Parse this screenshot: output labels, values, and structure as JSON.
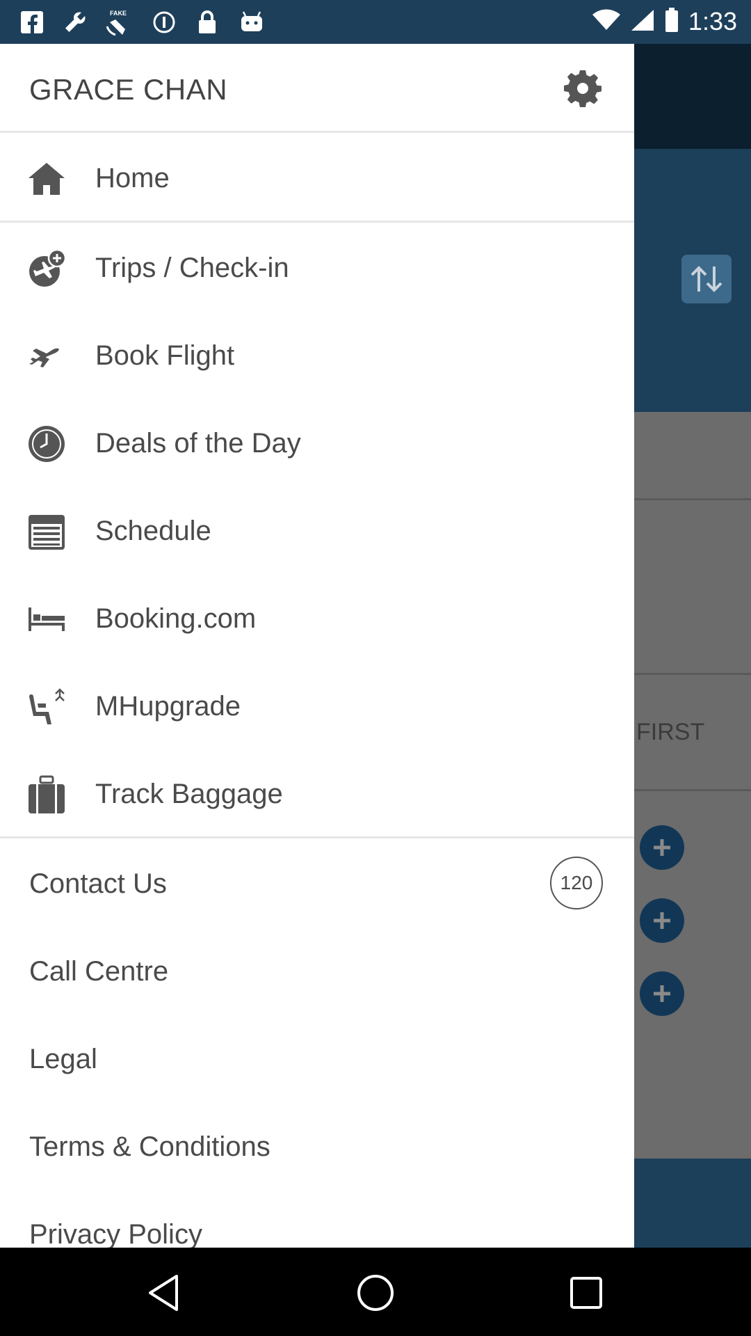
{
  "status_bar": {
    "time": "1:33",
    "left_icons": [
      "facebook-icon",
      "wrench-icon",
      "fake-gps-icon",
      "info-icon",
      "lock-icon",
      "android-icon"
    ],
    "right_icons": [
      "wifi-icon",
      "signal-icon",
      "battery-icon"
    ]
  },
  "drawer": {
    "user_name": "GRACE CHAN",
    "settings_icon": "gear-icon",
    "nav_items": [
      {
        "label": "Home",
        "icon": "home-icon"
      },
      {
        "label": "Trips / Check-in",
        "icon": "trips-checkin-icon"
      },
      {
        "label": "Book Flight",
        "icon": "airplane-icon"
      },
      {
        "label": "Deals of the Day",
        "icon": "clock-icon"
      },
      {
        "label": "Schedule",
        "icon": "schedule-icon"
      },
      {
        "label": "Booking.com",
        "icon": "bed-icon"
      },
      {
        "label": "MHupgrade",
        "icon": "seat-upgrade-icon"
      },
      {
        "label": "Track Baggage",
        "icon": "baggage-icon"
      }
    ],
    "secondary_items": [
      {
        "label": "Contact Us",
        "badge": "120"
      },
      {
        "label": "Call Centre"
      },
      {
        "label": "Legal"
      },
      {
        "label": "Terms & Conditions"
      },
      {
        "label": "Privacy Policy"
      }
    ]
  },
  "background": {
    "cabin_text": "FIRST",
    "swap_icon": "swap-arrows-icon",
    "add_icons": [
      "plus-circle-icon",
      "plus-circle-icon",
      "plus-circle-icon"
    ]
  },
  "navigation_bar": {
    "buttons": [
      "back-icon",
      "home-circle-icon",
      "recents-icon"
    ]
  },
  "colors": {
    "header_dark": "#0b1f2e",
    "brand_blue": "#1c3f5a",
    "scrim_gray": "#6c6c6c",
    "drawer_bg": "#ffffff",
    "text": "#4a4a4a"
  }
}
